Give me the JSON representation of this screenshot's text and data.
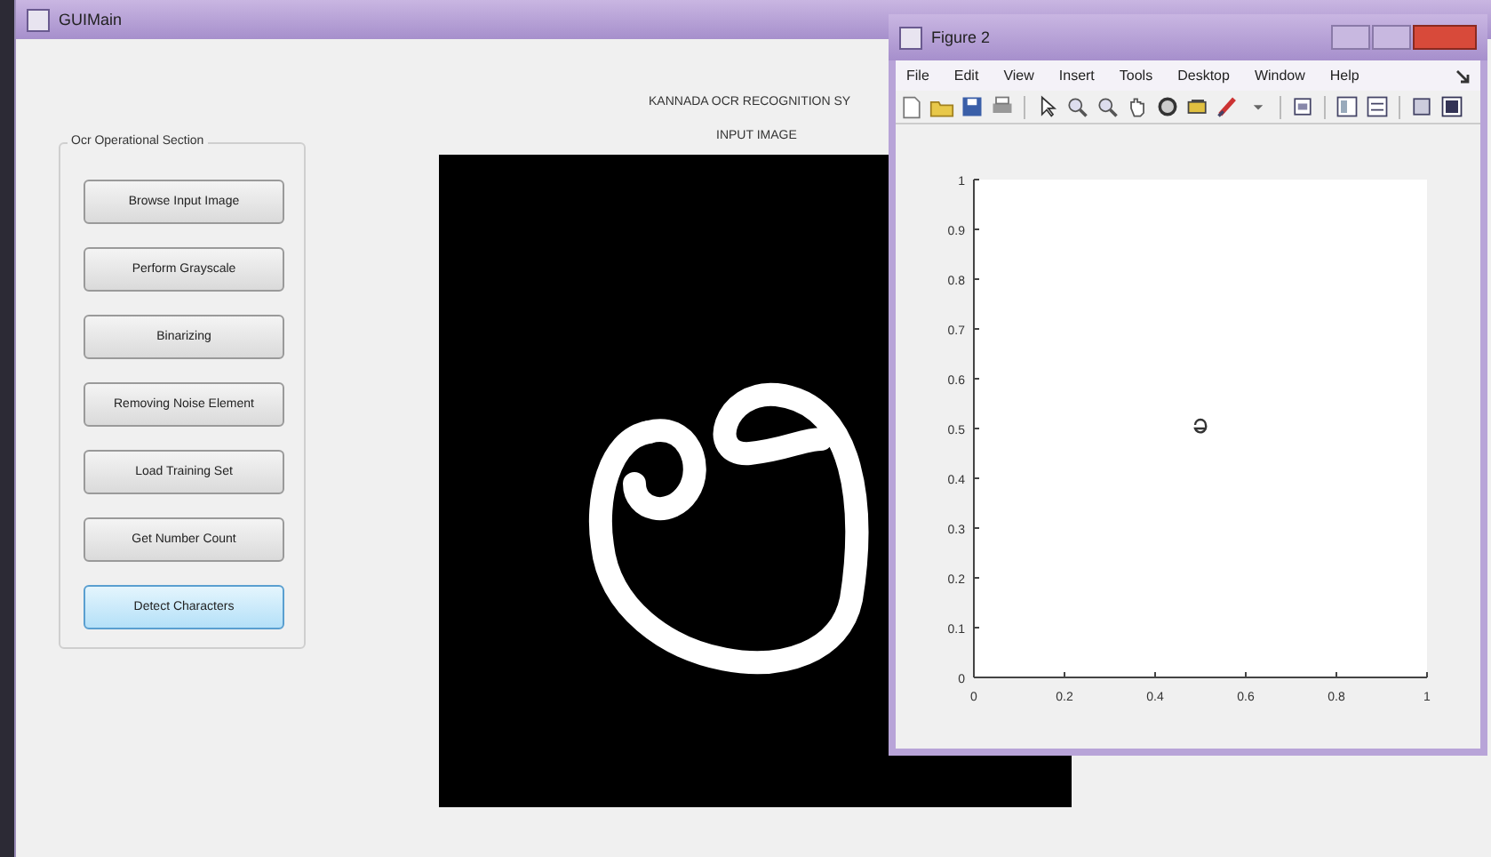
{
  "main_window": {
    "title": "GUIMain"
  },
  "heading": "KANNADA OCR RECOGNITION SY",
  "image_label": "INPUT IMAGE",
  "panel": {
    "title": "Ocr Operational Section",
    "buttons": [
      {
        "label": "Browse Input Image",
        "selected": false
      },
      {
        "label": "Perform Grayscale",
        "selected": false
      },
      {
        "label": "Binarizing",
        "selected": false
      },
      {
        "label": "Removing Noise Element",
        "selected": false
      },
      {
        "label": "Load Training Set",
        "selected": false
      },
      {
        "label": "Get Number Count",
        "selected": false
      },
      {
        "label": "Detect Characters",
        "selected": true
      }
    ]
  },
  "figure_window": {
    "title": "Figure 2",
    "menu": [
      "File",
      "Edit",
      "View",
      "Insert",
      "Tools",
      "Desktop",
      "Window",
      "Help"
    ],
    "chart_data": {
      "type": "scatter",
      "xlim": [
        0,
        1
      ],
      "ylim": [
        0,
        1
      ],
      "xticks": [
        0,
        0.2,
        0.4,
        0.6,
        0.8,
        1
      ],
      "yticks": [
        0,
        0.1,
        0.2,
        0.3,
        0.4,
        0.5,
        0.6,
        0.7,
        0.8,
        0.9,
        1
      ]
    }
  }
}
